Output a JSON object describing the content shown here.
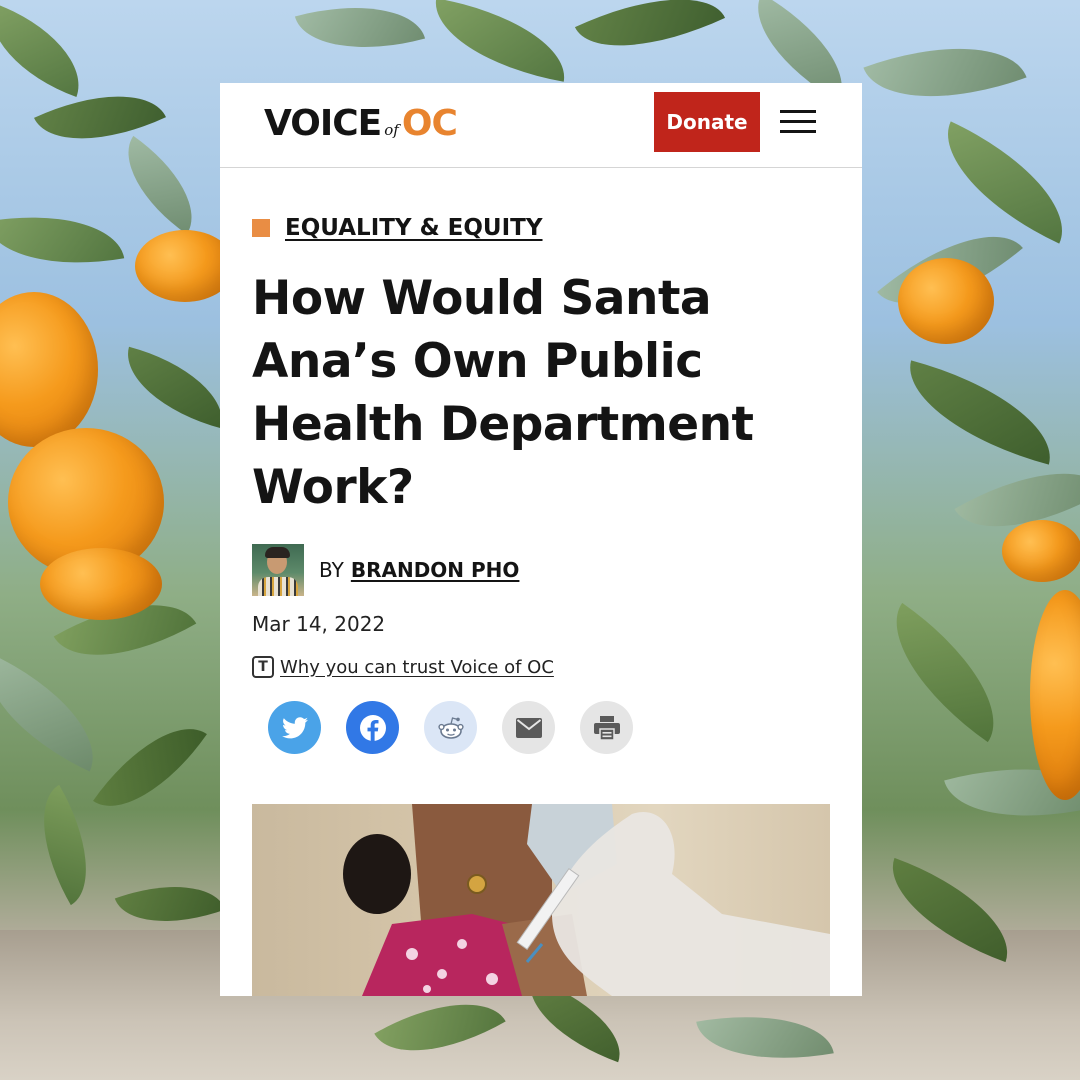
{
  "site": {
    "logo_voice": "VOICE",
    "logo_of": "of",
    "logo_oc": "OC",
    "donate_label": "Donate",
    "menu_icon": "hamburger-menu-icon"
  },
  "article": {
    "category": "EQUALITY & EQUITY",
    "headline_lines": [
      "How Would Santa",
      "Ana’s Own Public",
      "Health Department",
      "Work?"
    ],
    "by_prefix": "BY",
    "author": "BRANDON PHO",
    "date": "Mar 14, 2022",
    "trust_link": " Why you can trust Voice of OC",
    "trust_icon_letter": "T"
  },
  "share": [
    {
      "name": "twitter",
      "icon": "twitter-icon",
      "color": "#4aa3e8"
    },
    {
      "name": "facebook",
      "icon": "facebook-icon",
      "color": "#3178e6"
    },
    {
      "name": "reddit",
      "icon": "reddit-icon",
      "color": "#dbe6f6"
    },
    {
      "name": "email",
      "icon": "email-icon",
      "color": "#e5e5e5"
    },
    {
      "name": "print",
      "icon": "print-icon",
      "color": "#e5e5e5"
    }
  ],
  "colors": {
    "accent_orange": "#e8842f",
    "donate_red": "#c0251b",
    "text": "#141414"
  }
}
